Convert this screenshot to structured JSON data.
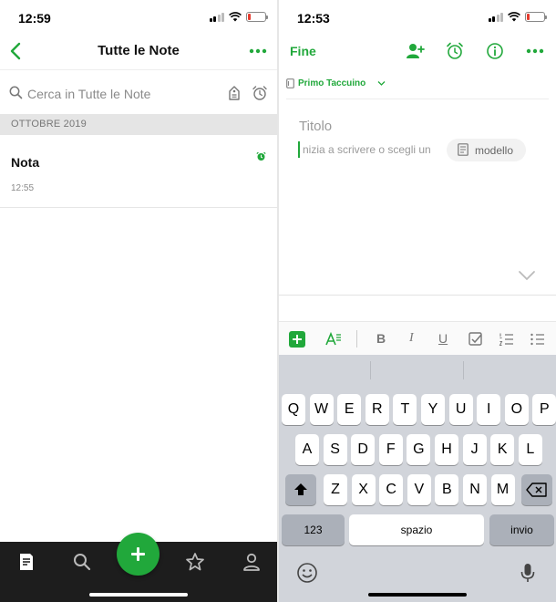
{
  "left": {
    "status_time": "12:59",
    "nav_title": "Tutte le Note",
    "search_placeholder": "Cerca in Tutte le Note",
    "section_header": "OTTOBRE 2019",
    "note": {
      "title": "Nota",
      "time": "12:55"
    }
  },
  "right": {
    "status_time": "12:53",
    "done_label": "Fine",
    "notebook_label": "Primo Taccuino",
    "title_placeholder": "Titolo",
    "body_placeholder": "nizia a scrivere o scegli un",
    "template_label": "modello",
    "keyboard": {
      "row1": [
        "Q",
        "W",
        "E",
        "R",
        "T",
        "Y",
        "U",
        "I",
        "O",
        "P"
      ],
      "row2": [
        "A",
        "S",
        "D",
        "F",
        "G",
        "H",
        "J",
        "K",
        "L"
      ],
      "row3": [
        "Z",
        "X",
        "C",
        "V",
        "B",
        "N",
        "M"
      ],
      "numbers_label": "123",
      "space_label": "spazio",
      "return_label": "invio"
    }
  },
  "colors": {
    "accent": "#21a83b",
    "tabbar": "#1d1d1d",
    "keyboard_bg": "#d1d4da",
    "battery_low": "#e63b2e"
  },
  "icons": [
    "back-chevron-icon",
    "more-icon",
    "search-icon",
    "tag-icon",
    "alarm-icon",
    "notes-icon",
    "star-icon",
    "profile-icon",
    "add-user-icon",
    "info-icon",
    "notebook-icon",
    "template-icon",
    "bold-icon",
    "italic-icon",
    "underline-icon",
    "checkbox-icon",
    "numbered-list-icon",
    "bullet-list-icon",
    "text-style-icon",
    "backspace-icon",
    "shift-icon",
    "emoji-icon",
    "microphone-icon"
  ]
}
